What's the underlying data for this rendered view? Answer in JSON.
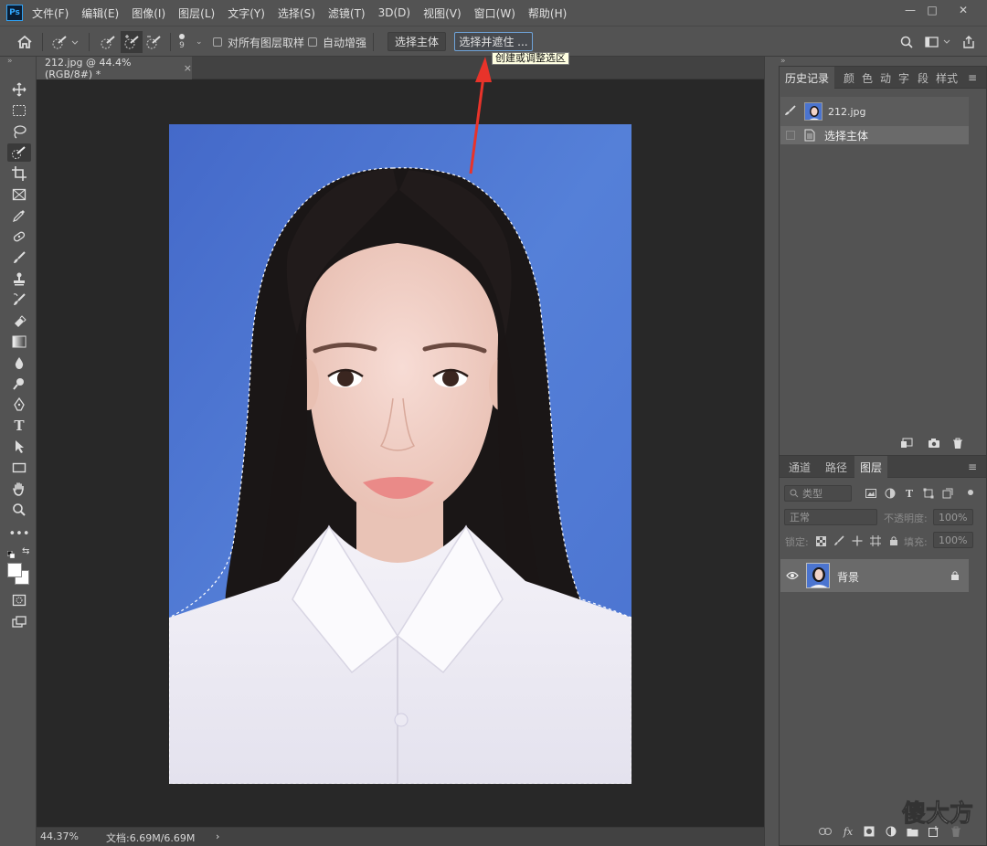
{
  "app": {
    "logo_text": "Ps"
  },
  "menu": {
    "items": [
      "文件(F)",
      "编辑(E)",
      "图像(I)",
      "图层(L)",
      "文字(Y)",
      "选择(S)",
      "滤镜(T)",
      "3D(D)",
      "视图(V)",
      "窗口(W)",
      "帮助(H)"
    ]
  },
  "window_controls": {
    "minimize": "—",
    "maximize": "□",
    "close": "✕"
  },
  "options": {
    "brush_size": "9",
    "sample_all_layers_label": "对所有图层取样",
    "auto_enhance_label": "自动增强",
    "select_subject_label": "选择主体",
    "select_and_mask_label": "选择并遮住 ...",
    "tooltip": "创建或调整选区"
  },
  "document": {
    "tab_title": "212.jpg @ 44.4%(RGB/8#) *",
    "tab_close": "×",
    "zoom": "44.37%",
    "doc_size": "文档:6.69M/6.69M",
    "status_arrow": "›"
  },
  "history_panel": {
    "tabs": [
      "历史记录",
      "颜",
      "色",
      "动",
      "字",
      "段",
      "样式"
    ],
    "snapshot_name": "212.jpg",
    "steps": [
      "选择主体"
    ]
  },
  "layers_panel": {
    "tabs": [
      "通道",
      "路径",
      "图层"
    ],
    "filter_placeholder": "类型",
    "blend_mode": "正常",
    "opacity_label": "不透明度:",
    "opacity_value": "100%",
    "lock_label": "锁定:",
    "fill_label": "填充:",
    "fill_value": "100%",
    "layers": [
      {
        "name": "背景",
        "visible": true,
        "locked": true
      }
    ]
  },
  "watermark": "傻大方",
  "colors": {
    "photo_background": "#4b74cf",
    "ui_dark": "#535353",
    "canvas_bg": "#282828",
    "accent_arrow": "#e8332a"
  }
}
